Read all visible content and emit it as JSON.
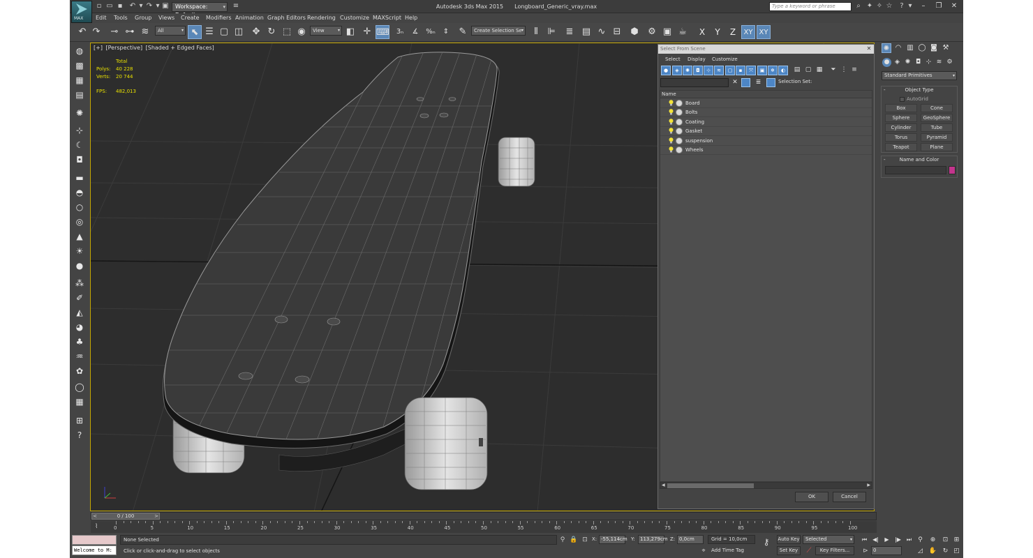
{
  "titlebar": {
    "workspace": "Workspace: Default",
    "app_name": "Autodesk 3ds Max  2015",
    "file_name": "Longboard_Generic_vray.max",
    "search_placeholder": "Type a keyword or phrase",
    "logo_label": "MAX"
  },
  "menu": [
    "Edit",
    "Tools",
    "Group",
    "Views",
    "Create",
    "Modifiers",
    "Animation",
    "Graph Editors",
    "Rendering",
    "Customize",
    "MAXScript",
    "Help"
  ],
  "toolbar": {
    "selection_filter": "All",
    "ref_coord": "View",
    "named_selection": "Create Selection Se",
    "axes": [
      "X",
      "Y",
      "Z",
      "XY",
      "XY"
    ]
  },
  "viewport": {
    "label_parts": [
      "[+]",
      "[Perspective]",
      "[Shaded + Edged Faces]"
    ],
    "stats": {
      "total_label": "Total",
      "polys_label": "Polys:",
      "polys_value": "40 228",
      "verts_label": "Verts:",
      "verts_value": "20 744",
      "fps_label": "FPS:",
      "fps_value": "482,013"
    }
  },
  "dialog": {
    "title": "Select From Scene",
    "menu": [
      "Select",
      "Display",
      "Customize"
    ],
    "selection_set_label": "Selection Set:",
    "column_name": "Name",
    "objects": [
      "Board",
      "Bolts",
      "Coating",
      "Gasket",
      "suspension",
      "Wheels"
    ],
    "ok_label": "OK",
    "cancel_label": "Cancel"
  },
  "command_panel": {
    "dropdown": "Standard Primitives",
    "object_type_title": "Object Type",
    "autogrid_label": "AutoGrid",
    "primitives": [
      "Box",
      "Cone",
      "Sphere",
      "GeoSphere",
      "Cylinder",
      "Tube",
      "Torus",
      "Pyramid",
      "Teapot",
      "Plane"
    ],
    "name_color_title": "Name and Color",
    "object_color": "#c3358d"
  },
  "timeline": {
    "slider_label": "0 / 100",
    "ticks": [
      "0",
      "5",
      "10",
      "15",
      "20",
      "25",
      "30",
      "35",
      "40",
      "45",
      "50",
      "55",
      "60",
      "65",
      "70",
      "75",
      "80",
      "85",
      "90",
      "95",
      "100"
    ]
  },
  "status": {
    "selection": "None Selected",
    "prompt": "Click or click-and-drag to select objects",
    "listener": "Welcome to M:",
    "x_label": "X:",
    "x_value": "-55,114cm",
    "y_label": "Y:",
    "y_value": "113,279cm",
    "z_label": "Z:",
    "z_value": "0,0cm",
    "grid": "Grid = 10,0cm",
    "add_time_tag": "Add Time Tag",
    "auto_key": "Auto Key",
    "set_key": "Set Key",
    "key_mode": "Selected",
    "key_filters": "Key Filters...",
    "frame": "0"
  },
  "colors": {
    "viewport_bg": "#2d2d2d",
    "active_border": "#c4a700",
    "stats_text": "#e8e000",
    "accent_blue": "#5a87b7"
  }
}
